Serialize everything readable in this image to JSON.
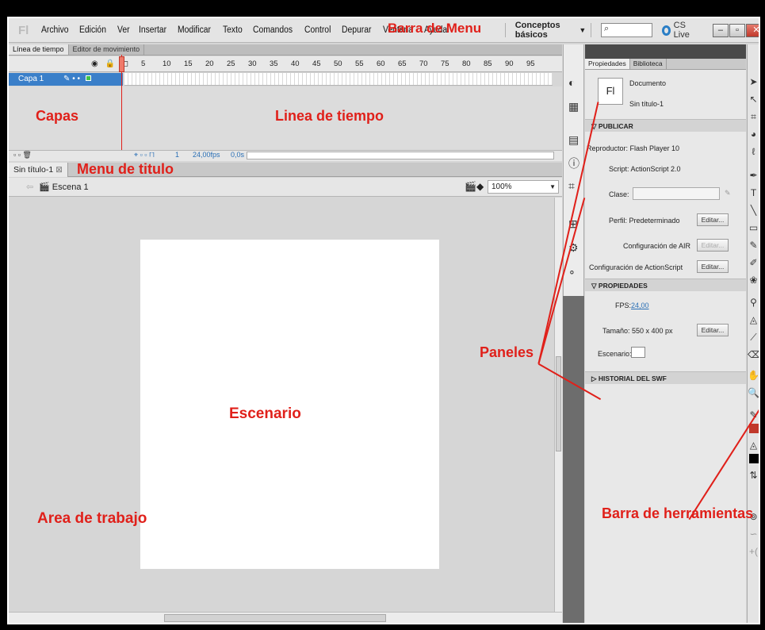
{
  "menu": {
    "items": [
      "Archivo",
      "Edición",
      "Ver",
      "Insertar",
      "Modificar",
      "Texto",
      "Comandos",
      "Control",
      "Depurar",
      "Ventana",
      "Ayuda"
    ],
    "workspace": "Conceptos básicos",
    "search_placeholder": "",
    "cslive": "CS Live"
  },
  "timeline": {
    "tabs": [
      "Línea de tiempo",
      "Editor de movimiento"
    ],
    "ruler": [
      "5",
      "10",
      "15",
      "20",
      "25",
      "30",
      "35",
      "40",
      "45",
      "50",
      "55",
      "60",
      "65",
      "70",
      "75",
      "80",
      "85",
      "90",
      "95"
    ],
    "layer": "Capa 1",
    "fps": "24,00fps",
    "time": "0,0s",
    "frame": "1"
  },
  "document": {
    "tab": "Sin título-1",
    "scene": "Escena 1",
    "zoom": "100%"
  },
  "properties": {
    "tabs": [
      "Propiedades",
      "Biblioteca"
    ],
    "doc_label": "Documento",
    "doc_name": "Sin título-1",
    "fl": "Fl",
    "publicar": "PUBLICAR",
    "reproductor": "Reproductor:  Flash Player 10",
    "script": "Script:  ActionScript 2.0",
    "clase": "Clase:",
    "perfil": "Perfil:  Predeterminado",
    "editar": "Editar...",
    "air": "Configuración de AIR",
    "actionscript": "Configuración de ActionScript",
    "propiedades": "PROPIEDADES",
    "fps_label": "FPS:",
    "fps_value": "24,00",
    "tamano": "Tamaño:  550 x 400 px",
    "escenario": "Escenario:",
    "historial": "HISTORIAL DEL SWF"
  },
  "annotations": {
    "barra_menu": "Barra de Menu",
    "capas": "Capas",
    "linea_tiempo": "Linea de tiempo",
    "menu_titulo": "Menu de titulo",
    "paneles": "Paneles",
    "escenario": "Escenario",
    "area_trabajo": "Area de trabajo",
    "barra_herramientas": "Barra de herramientas"
  },
  "colors": {
    "annotation": "#e0201a",
    "layer": "#3a7fc9",
    "fill": "#c0392b",
    "stroke": "#000000"
  }
}
